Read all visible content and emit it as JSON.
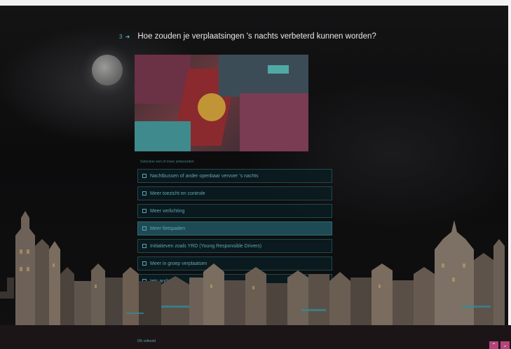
{
  "question": {
    "number": "3 ➜",
    "title": "Hoe zouden je verplaatsingen 's nachts verbeterd kunnen worden?",
    "hint": "Selecteer een of meer antwoorden"
  },
  "options": [
    {
      "label": "Nachtbussen of ander openbaar vervoer 's nachts",
      "selected": false
    },
    {
      "label": "Meer toezicht en controle",
      "selected": false
    },
    {
      "label": "Meer verlichting",
      "selected": false
    },
    {
      "label": "Meer fietspaden",
      "selected": true
    },
    {
      "label": "Initiatieven zoals YRD (Young Responsible Drivers)",
      "selected": false
    },
    {
      "label": "Meer in groep verplaatsen",
      "selected": false
    },
    {
      "label": "Iets anders",
      "selected": false
    }
  ],
  "footer": {
    "status": "0% voltooid"
  },
  "nav": {
    "up_label": "⌃",
    "down_label": "⌄"
  },
  "colors": {
    "accent": "#4fb7c7",
    "option_text": "#5fa9b4",
    "selected_bg": "#1d4a53",
    "nav_button": "#b3457a"
  }
}
